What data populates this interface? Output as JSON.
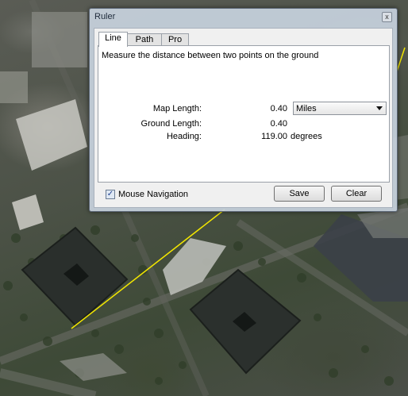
{
  "window": {
    "title": "Ruler",
    "close_glyph": "x"
  },
  "tabs": [
    {
      "label": "Line",
      "active": true
    },
    {
      "label": "Path",
      "active": false
    },
    {
      "label": "Pro",
      "active": false
    }
  ],
  "panel": {
    "description": "Measure the distance between two points on the ground",
    "map_length_label": "Map Length:",
    "map_length_value": "0.40",
    "units_selected": "Miles",
    "ground_length_label": "Ground Length:",
    "ground_length_value": "0.40",
    "heading_label": "Heading:",
    "heading_value": "119.00",
    "heading_unit": "degrees"
  },
  "footer": {
    "mouse_navigation_label": "Mouse Navigation",
    "mouse_navigation_checked": true,
    "save_label": "Save",
    "clear_label": "Clear"
  },
  "colors": {
    "measure_line": "#f2e600"
  }
}
